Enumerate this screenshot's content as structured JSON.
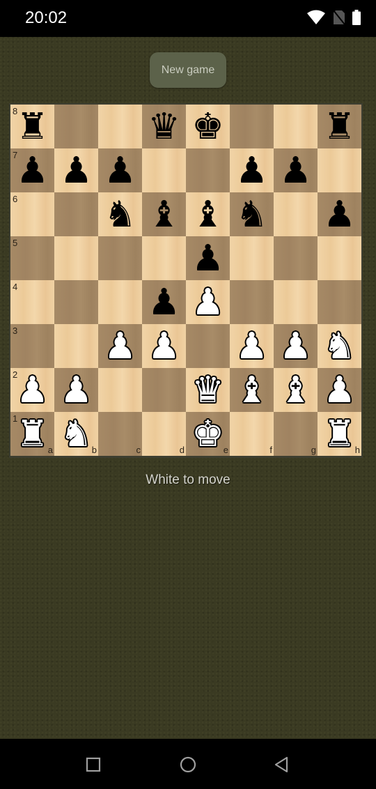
{
  "status_bar": {
    "time": "20:02",
    "icons": [
      "wifi-icon",
      "no-sim-icon",
      "battery-icon"
    ]
  },
  "toolbar": {
    "new_game_label": "New game"
  },
  "board": {
    "orientation": "white-bottom",
    "files": [
      "a",
      "b",
      "c",
      "d",
      "e",
      "f",
      "g",
      "h"
    ],
    "ranks": [
      "8",
      "7",
      "6",
      "5",
      "4",
      "3",
      "2",
      "1"
    ],
    "colors": {
      "light": "#f0d2a4",
      "dark": "#a68a66"
    },
    "position": [
      [
        "bR",
        "",
        "",
        "bQ",
        "bK",
        "",
        "",
        "bR"
      ],
      [
        "bP",
        "bP",
        "bP",
        "",
        "",
        "bP",
        "bP",
        ""
      ],
      [
        "",
        "",
        "bN",
        "bB",
        "bB",
        "bN",
        "",
        "bP"
      ],
      [
        "",
        "",
        "",
        "",
        "bP",
        "",
        "",
        ""
      ],
      [
        "",
        "",
        "",
        "bP",
        "wP",
        "",
        "",
        ""
      ],
      [
        "",
        "",
        "wP",
        "wP",
        "",
        "wP",
        "wP",
        "wN"
      ],
      [
        "wP",
        "wP",
        "",
        "",
        "wQ",
        "wB",
        "wB",
        "wP"
      ],
      [
        "wR",
        "wN",
        "",
        "",
        "wK",
        "",
        "",
        "wR"
      ]
    ],
    "glyphs": {
      "K": "♚",
      "Q": "♛",
      "R": "♜",
      "B": "♝",
      "N": "♞",
      "P": "♟"
    },
    "piece_names": {
      "K": "king",
      "Q": "queen",
      "R": "rook",
      "B": "bishop",
      "N": "knight",
      "P": "pawn"
    }
  },
  "game_status": {
    "text": "White to move"
  },
  "nav_bar": {
    "buttons": [
      "recents-button",
      "home-button",
      "back-button"
    ]
  }
}
